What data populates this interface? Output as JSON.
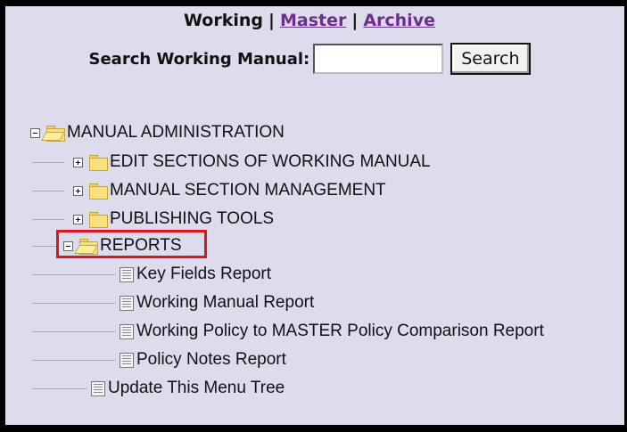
{
  "nav": {
    "current": "Working",
    "separator": "|",
    "links": [
      {
        "label": "Master"
      },
      {
        "label": "Archive"
      }
    ]
  },
  "search": {
    "label": "Search Working Manual:",
    "value": "",
    "button_label": "Search"
  },
  "tree": {
    "root": {
      "label": "MANUAL ADMINISTRATION",
      "expanded": true
    },
    "children": [
      {
        "label": "EDIT SECTIONS OF WORKING MANUAL",
        "expanded": false
      },
      {
        "label": "MANUAL SECTION MANAGEMENT",
        "expanded": false
      },
      {
        "label": "PUBLISHING TOOLS",
        "expanded": false
      },
      {
        "label": "REPORTS",
        "expanded": true,
        "highlighted": true,
        "items": [
          {
            "label": "Key Fields Report"
          },
          {
            "label": "Working Manual Report"
          },
          {
            "label": "Working Policy to MASTER Policy Comparison Report"
          },
          {
            "label": "Policy Notes Report"
          }
        ]
      },
      {
        "label": "Update This Menu Tree"
      }
    ]
  },
  "colors": {
    "panel_background": "#dcdcec",
    "link": "#6d2e8c",
    "highlight_border": "#e0141c",
    "folder": "#f8e07c"
  },
  "icons": [
    "minus-toggle-icon",
    "plus-toggle-icon",
    "folder-icon",
    "open-folder-icon",
    "document-icon"
  ]
}
